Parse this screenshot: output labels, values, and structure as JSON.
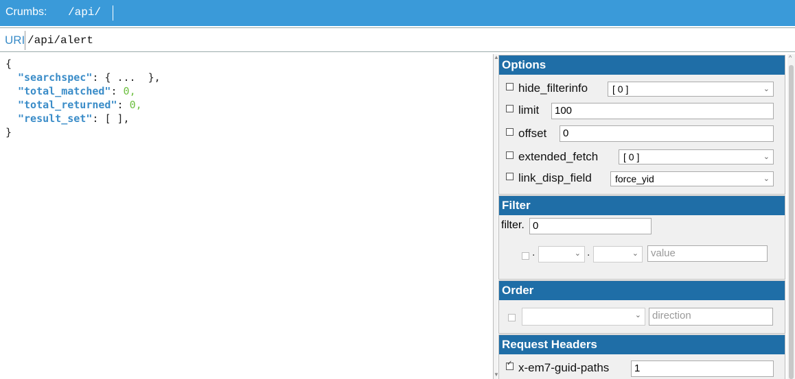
{
  "crumbs": {
    "label": "Crumbs:",
    "path": "/api/"
  },
  "uri": {
    "label": "URI",
    "value": "/api/alert"
  },
  "json": {
    "open": "{",
    "close": "}",
    "entries": [
      {
        "key": "\"searchspec\"",
        "colon": ": ",
        "value": "{ ...  },",
        "type": "plain"
      },
      {
        "key": "\"total_matched\"",
        "colon": ": ",
        "value": "0",
        "tail": ",",
        "type": "num"
      },
      {
        "key": "\"total_returned\"",
        "colon": ": ",
        "value": "0",
        "tail": ",",
        "type": "num"
      },
      {
        "key": "\"result_set\"",
        "colon": ": ",
        "value": "[ ],",
        "type": "plain"
      }
    ]
  },
  "options": {
    "title": "Options",
    "hide_filterinfo": {
      "label": "hide_filterinfo",
      "value": "[ 0 ]"
    },
    "limit": {
      "label": "limit",
      "value": "100"
    },
    "offset": {
      "label": "offset",
      "value": "0"
    },
    "extended_fetch": {
      "label": "extended_fetch",
      "value": "[ 0 ]"
    },
    "link_disp_field": {
      "label": "link_disp_field",
      "value": "force_yid"
    }
  },
  "filter": {
    "title": "Filter",
    "label": "filter.",
    "index": "0",
    "dot": ".",
    "value_placeholder": "value"
  },
  "order": {
    "title": "Order",
    "direction_placeholder": "direction"
  },
  "request_headers": {
    "title": "Request Headers",
    "header": {
      "label": "x-em7-guid-paths",
      "value": "1"
    }
  }
}
